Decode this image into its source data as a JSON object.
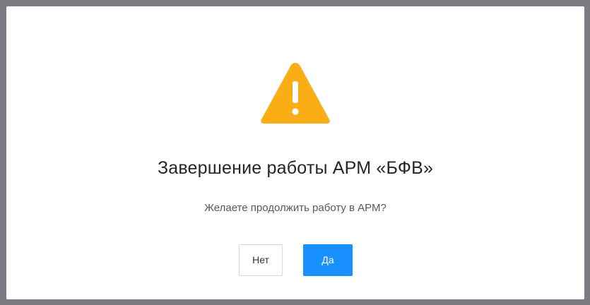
{
  "dialog": {
    "icon": "warning-triangle-icon",
    "title": "Завершение работы АРМ «БФВ»",
    "message": "Желаете продолжить работу в АРМ?",
    "buttons": {
      "no_label": "Нет",
      "yes_label": "Да"
    }
  },
  "colors": {
    "overlay": "#7a7c82",
    "dialog_background": "#ffffff",
    "warning": "#faad14",
    "primary": "#1890ff"
  }
}
